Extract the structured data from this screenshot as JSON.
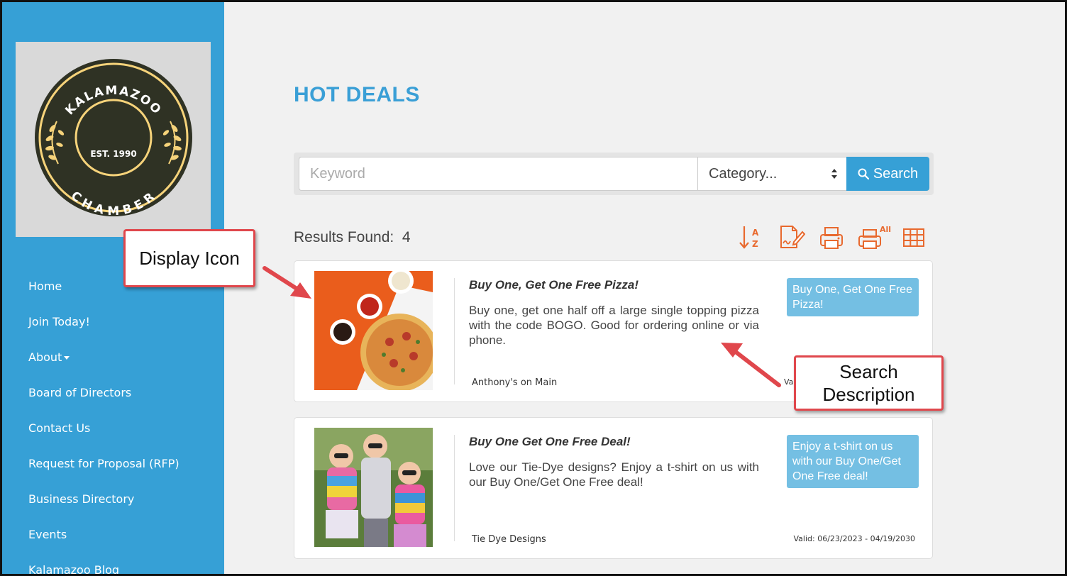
{
  "sidebar": {
    "logo": {
      "top_text": "KALAMAZOO",
      "center_text": "EST. 1990",
      "bottom_text": "CHAMBER",
      "colors": {
        "ring": "#2f3224",
        "accent": "#f6d37a",
        "background": "#d9d9d9"
      }
    },
    "nav": [
      {
        "label": "Home"
      },
      {
        "label": "Join Today!"
      },
      {
        "label": "About"
      },
      {
        "label": "Board of Directors"
      },
      {
        "label": "Contact Us"
      },
      {
        "label": "Request for Proposal (RFP)"
      },
      {
        "label": "Business Directory"
      },
      {
        "label": "Events"
      },
      {
        "label": "Kalamazoo Blog"
      }
    ],
    "bg_color": "#36a0d6"
  },
  "page": {
    "title": "HOT DEALS"
  },
  "search": {
    "keyword_placeholder": "Keyword",
    "category_value": "Category...",
    "button_label": "Search"
  },
  "results": {
    "label": "Results Found:",
    "count": "4"
  },
  "toolbar": {
    "icons": [
      "sort-az-icon",
      "signature-icon",
      "print-icon",
      "print-all-icon",
      "grid-view-icon"
    ],
    "print_all_badge": "All",
    "icon_color": "#e8692e"
  },
  "deals": [
    {
      "title": "Buy One, Get One Free Pizza!",
      "description": "Buy one, get one half off a large single topping pizza with the code BOGO. Good for ordering online or via phone.",
      "business": "Anthony's on Main",
      "valid": "Va",
      "tag": "Buy One, Get One Free Pizza!",
      "image": "pizza-photo"
    },
    {
      "title": "Buy One Get One Free Deal!",
      "description": "Love our Tie-Dye designs? Enjoy a t-shirt on us with our Buy One/Get One Free deal!",
      "business": "Tie Dye Designs",
      "valid": "Valid: 06/23/2023 - 04/19/2030",
      "tag": "Enjoy a t-shirt on us with our Buy One/Get One Free deal!",
      "image": "kids-tie-dye-photo"
    }
  ],
  "annotations": {
    "display_icon": "Display Icon",
    "search_description_line1": "Search",
    "search_description_line2": "Description",
    "color": "#e0474c"
  }
}
